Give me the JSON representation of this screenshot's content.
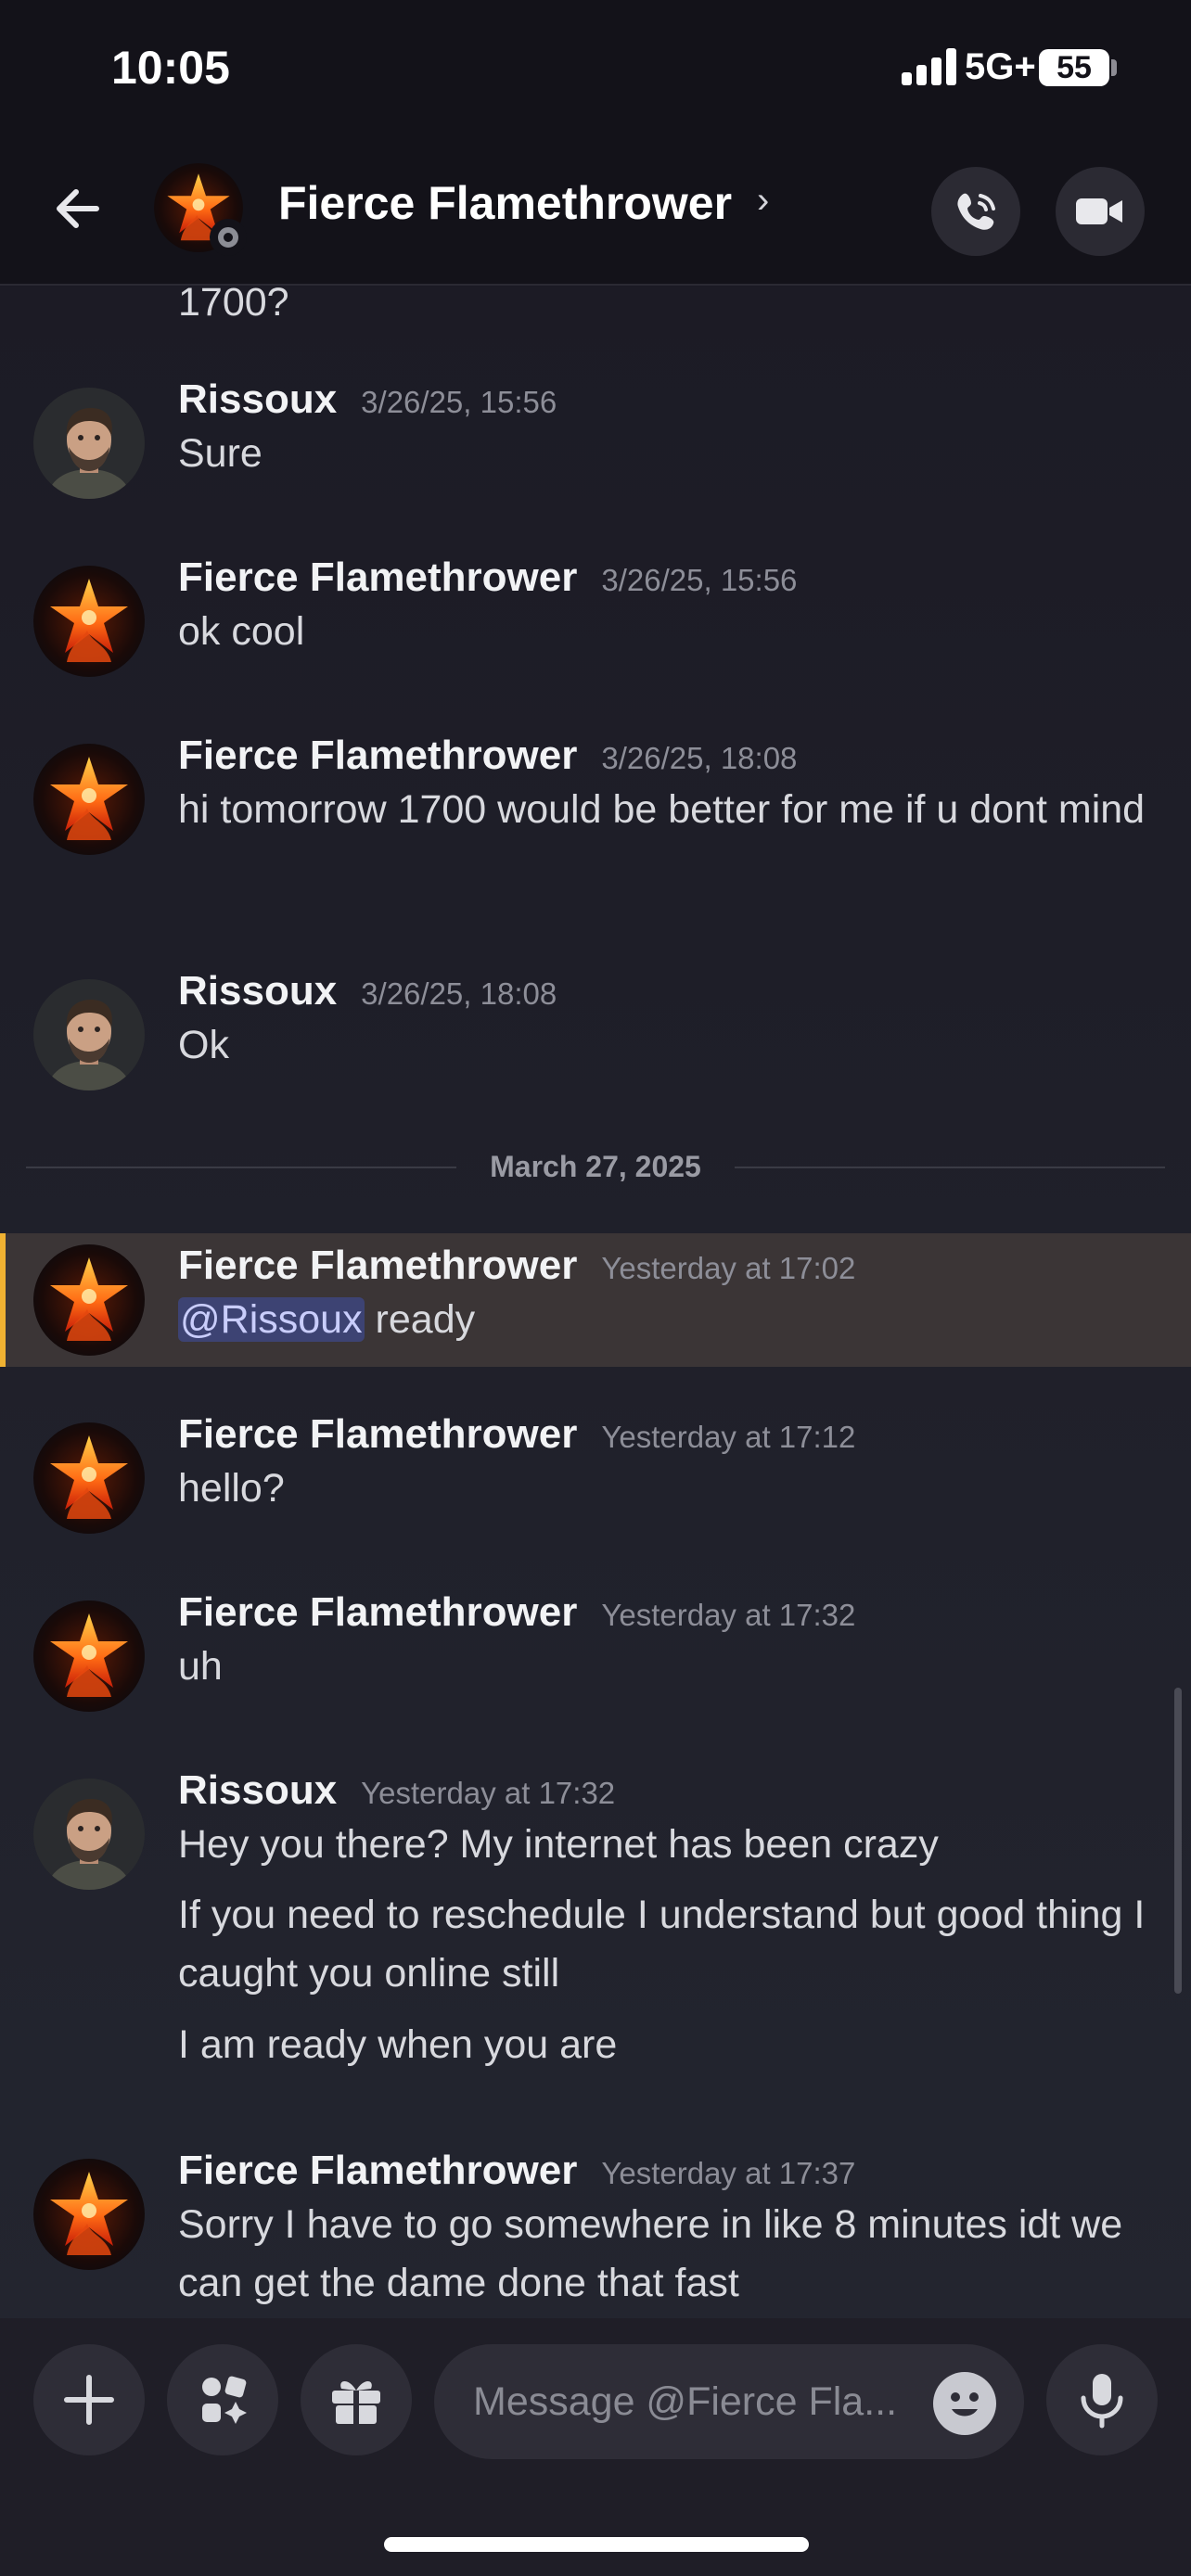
{
  "status_bar": {
    "time": "10:05",
    "network": "5G+",
    "battery": "55"
  },
  "header": {
    "title": "Fierce Flamethrower",
    "chevron": "›",
    "call_icon": "phone-icon",
    "video_icon": "video-camera-icon"
  },
  "messages": {
    "cut_text": "1700?",
    "items": [
      {
        "author": "Rissoux",
        "timestamp": "3/26/25, 15:56",
        "lines": [
          "Sure"
        ]
      },
      {
        "author": "Fierce Flamethrower",
        "timestamp": "3/26/25, 15:56",
        "lines": [
          "ok cool"
        ]
      },
      {
        "author": "Fierce Flamethrower",
        "timestamp": "3/26/25, 18:08",
        "lines": [
          "hi tomorrow 1700 would be better for me if u dont mind"
        ]
      },
      {
        "author": "Rissoux",
        "timestamp": "3/26/25, 18:08",
        "lines": [
          "Ok"
        ]
      },
      {
        "author": "Fierce Flamethrower",
        "timestamp": "Yesterday at 17:02",
        "mention": "@Rissoux",
        "lines": [
          "ready"
        ]
      },
      {
        "author": "Fierce Flamethrower",
        "timestamp": "Yesterday at 17:12",
        "lines": [
          "hello?"
        ]
      },
      {
        "author": "Fierce Flamethrower",
        "timestamp": "Yesterday at 17:32",
        "lines": [
          "uh"
        ]
      },
      {
        "author": "Rissoux",
        "timestamp": "Yesterday at 17:32",
        "lines": [
          "Hey you there? My internet has been crazy",
          "If you need to reschedule I understand but good thing I caught you online still",
          "I am ready when you are"
        ]
      },
      {
        "author": "Fierce Flamethrower",
        "timestamp": "Yesterday at 17:37",
        "lines": [
          "Sorry I have to go somewhere in like 8 minutes idt we can get the dame done that fast"
        ]
      }
    ],
    "date_divider": "March 27, 2025"
  },
  "composer": {
    "placeholder": "Message @Fierce Fla..."
  },
  "colors": {
    "background": "#1b1a24",
    "mention_highlight": "#f0b232",
    "mention_pill": "#3d4373"
  }
}
